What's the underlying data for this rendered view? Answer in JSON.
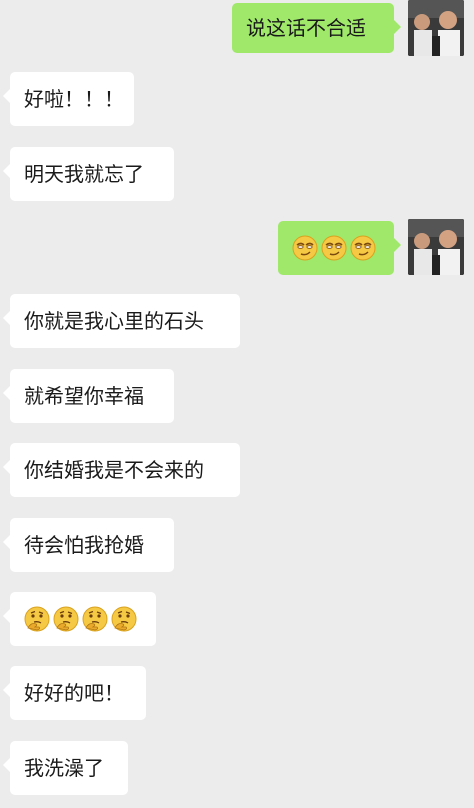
{
  "messages": [
    {
      "side": "right",
      "text": "说这话不合适"
    },
    {
      "side": "left",
      "text": "好啦！！！"
    },
    {
      "side": "left",
      "text": "明天我就忘了"
    },
    {
      "side": "right",
      "emoji": "smirk-face-icon",
      "count": 3
    },
    {
      "side": "left",
      "text": "你就是我心里的石头"
    },
    {
      "side": "left",
      "text": "就希望你幸福"
    },
    {
      "side": "left",
      "text": "你结婚我是不会来的"
    },
    {
      "side": "left",
      "text": "待会怕我抢婚"
    },
    {
      "side": "left",
      "emoji": "thinking-face-icon",
      "count": 4
    },
    {
      "side": "left",
      "text": "好好的吧！"
    },
    {
      "side": "left",
      "text": "我洗澡了"
    }
  ],
  "colors": {
    "background": "#ececec",
    "left_bubble": "#ffffff",
    "right_bubble": "#9fe86a",
    "text": "#1a1a1a"
  }
}
